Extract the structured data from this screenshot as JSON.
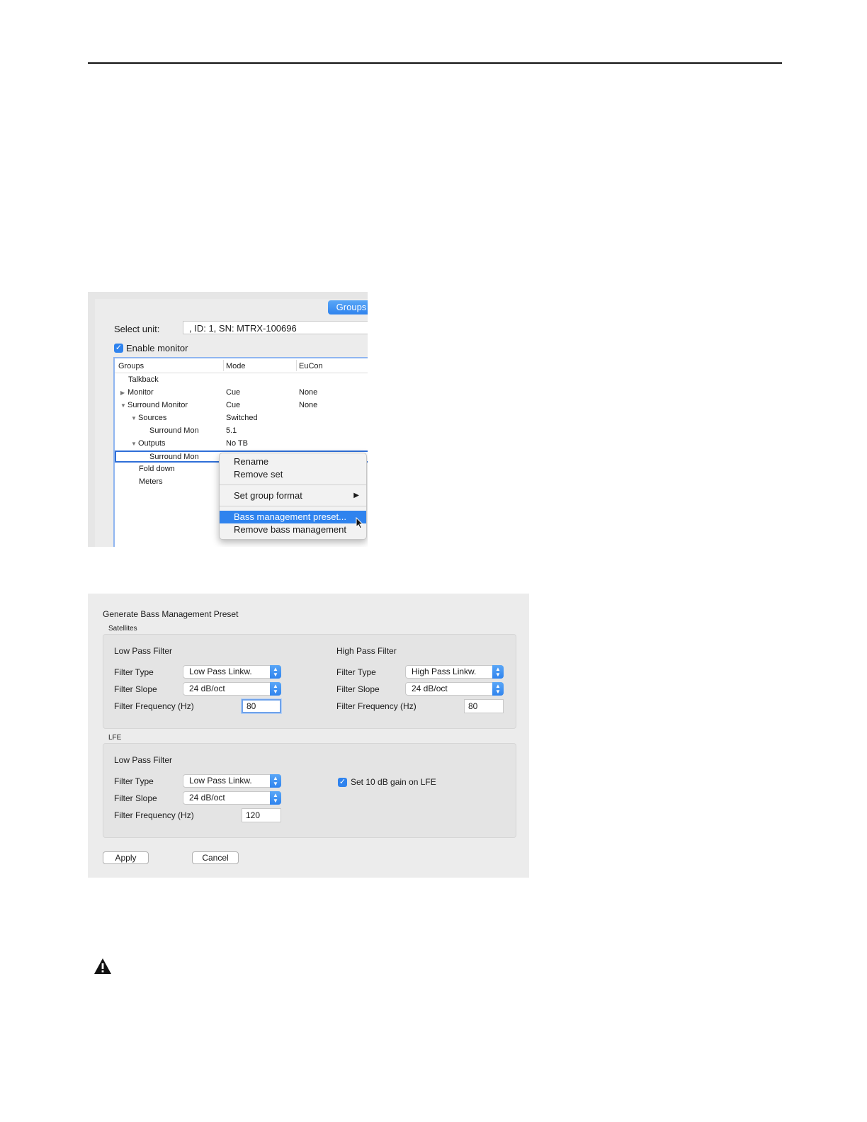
{
  "groups_panel": {
    "tab_label": "Groups",
    "select_unit_label": "Select unit:",
    "select_unit_value": ", ID: 1, SN: MTRX-100696",
    "enable_monitor_label": "Enable monitor",
    "columns": [
      "Groups",
      "Mode",
      "EuCon"
    ],
    "rows": [
      {
        "name": "Talkback",
        "mode": "",
        "eucon": ""
      },
      {
        "name": "Monitor",
        "mode": "Cue",
        "eucon": "None"
      },
      {
        "name": "Surround Monitor",
        "mode": "Cue",
        "eucon": "None"
      },
      {
        "name": "Sources",
        "mode": "Switched",
        "eucon": ""
      },
      {
        "name": "Surround Mon",
        "mode": "5.1",
        "eucon": ""
      },
      {
        "name": "Outputs",
        "mode": "No TB",
        "eucon": ""
      },
      {
        "name": "Surround Mon",
        "mode": "",
        "eucon": ""
      },
      {
        "name": "Fold down",
        "mode": "",
        "eucon": ""
      },
      {
        "name": "Meters",
        "mode": "",
        "eucon": ""
      }
    ],
    "context_menu": {
      "rename": "Rename",
      "remove_set": "Remove set",
      "set_group_format": "Set group format",
      "bass_management_preset": "Bass management preset...",
      "remove_bass_management": "Remove bass management"
    }
  },
  "bass_dialog": {
    "title": "Generate Bass Management Preset",
    "satellites_label": "Satellites",
    "lfe_label": "LFE",
    "low_pass_filter": "Low Pass Filter",
    "high_pass_filter": "High Pass Filter",
    "filter_type_label": "Filter Type",
    "filter_slope_label": "Filter Slope",
    "filter_frequency_label": "Filter Frequency (Hz)",
    "sat_lp_type": "Low Pass Linkw.",
    "sat_lp_slope": "24 dB/oct",
    "sat_lp_freq": "80",
    "sat_hp_type": "High Pass Linkw.",
    "sat_hp_slope": "24 dB/oct",
    "sat_hp_freq": "80",
    "lfe_lp_type": "Low Pass Linkw.",
    "lfe_lp_slope": "24 dB/oct",
    "lfe_lp_freq": "120",
    "lfe_gain_label": "Set 10 dB gain on LFE",
    "apply_label": "Apply",
    "cancel_label": "Cancel"
  },
  "colors": {
    "accent": "#2f83ee"
  },
  "icons": [
    "checkbox-checked-icon",
    "disclosure-triangle-icon",
    "submenu-arrow-icon",
    "mouse-cursor-icon",
    "stepper-icon",
    "warning-icon"
  ]
}
